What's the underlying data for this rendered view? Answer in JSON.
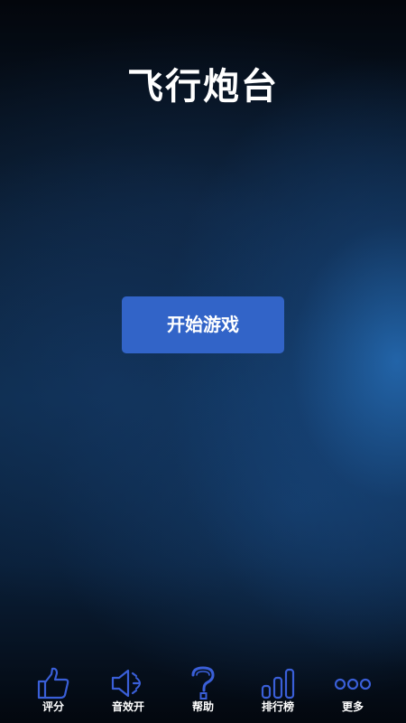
{
  "game": {
    "title": "飞行炮台",
    "start_label": "开始游戏"
  },
  "bottom_nav": {
    "items": [
      {
        "label": "评分",
        "icon": "thumbs-up-icon"
      },
      {
        "label": "音效开",
        "icon": "speaker-icon"
      },
      {
        "label": "帮助",
        "icon": "question-mark-icon"
      },
      {
        "label": "排行榜",
        "icon": "bar-chart-icon"
      },
      {
        "label": "更多",
        "icon": "more-dots-icon"
      }
    ]
  },
  "colors": {
    "accent": "#3264c8",
    "icon_stroke": "#3a5fd8",
    "text": "#ffffff"
  }
}
